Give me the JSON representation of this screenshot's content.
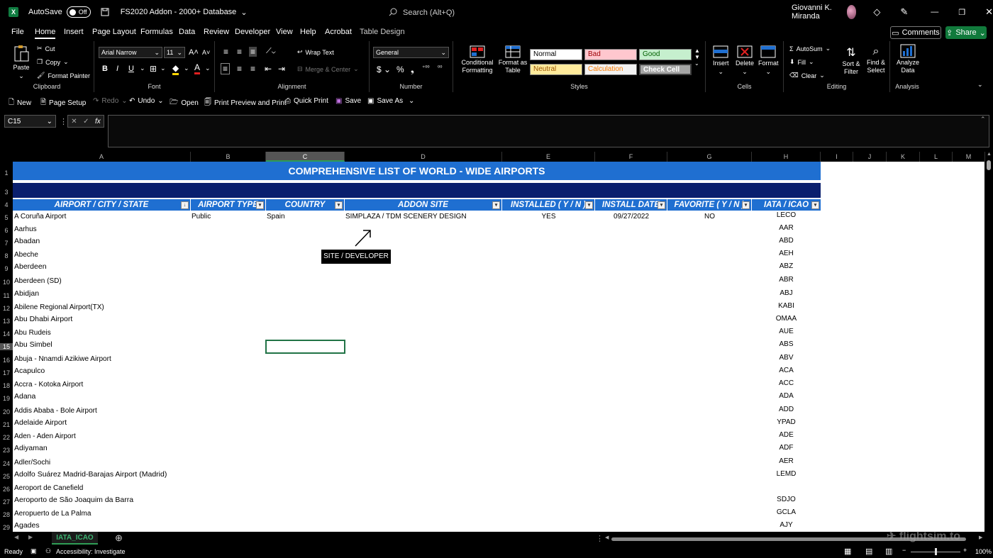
{
  "titlebar": {
    "autosave_label": "AutoSave",
    "autosave_state": "Off",
    "doc_title": "FS2020 Addon - 2000+ Database",
    "search_placeholder": "Search (Alt+Q)",
    "user_name": "Giovanni K. Miranda"
  },
  "menu": [
    "File",
    "Home",
    "Insert",
    "Page Layout",
    "Formulas",
    "Data",
    "Review",
    "Developer",
    "View",
    "Help",
    "Acrobat",
    "Table Design"
  ],
  "menu_active": "Home",
  "comments_label": "Comments",
  "share_label": "Share",
  "ribbon": {
    "clipboard": {
      "paste": "Paste",
      "cut": "Cut",
      "copy": "Copy",
      "format_painter": "Format Painter",
      "label": "Clipboard"
    },
    "font": {
      "name": "Arial Narrow",
      "size": "11",
      "label": "Font"
    },
    "alignment": {
      "wrap": "Wrap Text",
      "merge": "Merge & Center",
      "label": "Alignment"
    },
    "number": {
      "format": "General",
      "label": "Number"
    },
    "styles": {
      "conditional": "Conditional Formatting",
      "format_table": "Format as Table",
      "normal": "Normal",
      "bad": "Bad",
      "good": "Good",
      "neutral": "Neutral",
      "calculation": "Calculation",
      "check": "Check Cell",
      "label": "Styles"
    },
    "cells": {
      "insert": "Insert",
      "delete": "Delete",
      "format": "Format",
      "label": "Cells"
    },
    "editing": {
      "autosum": "AutoSum",
      "fill": "Fill",
      "clear": "Clear",
      "sort": "Sort & Filter",
      "find": "Find & Select",
      "label": "Editing"
    },
    "analysis": {
      "analyze": "Analyze Data",
      "label": "Analysis"
    }
  },
  "qat": [
    "New",
    "Page Setup",
    "Redo",
    "Undo",
    "Open",
    "Print Preview and Print",
    "Quick Print",
    "Save",
    "Save As"
  ],
  "namebox": "C15",
  "columns": [
    "A",
    "B",
    "C",
    "D",
    "E",
    "F",
    "G",
    "H",
    "I",
    "J",
    "K",
    "L",
    "M"
  ],
  "sheet": {
    "title": "COMPREHENSIVE LIST OF WORLD - WIDE AIRPORTS",
    "headers": [
      "AIRPORT / CITY / STATE",
      "AIRPORT TYPE",
      "COUNTRY",
      "ADDON SITE",
      "INSTALLED  ( Y / N )",
      "INSTALL DATE",
      "FAVORITE ( Y / N )",
      "IATA / ICAO"
    ],
    "first_row": {
      "type": "Public",
      "country": "Spain",
      "site": "SIMPLAZA / TDM SCENERY DESIGN",
      "installed": "YES",
      "date": "09/27/2022",
      "favorite": "NO"
    },
    "tooltip": "SITE / DEVELOPER",
    "rows": [
      {
        "n": "5",
        "name": "A Coruña Airport",
        "code": "LECO"
      },
      {
        "n": "6",
        "name": "Aarhus",
        "code": "AAR"
      },
      {
        "n": "7",
        "name": "Abadan",
        "code": "ABD"
      },
      {
        "n": "8",
        "name": "Abeche",
        "code": "AEH"
      },
      {
        "n": "9",
        "name": "Aberdeen",
        "code": "ABZ"
      },
      {
        "n": "10",
        "name": "Aberdeen (SD)",
        "code": "ABR"
      },
      {
        "n": "11",
        "name": "Abidjan",
        "code": "ABJ"
      },
      {
        "n": "12",
        "name": "Abilene Regional Airport(TX)",
        "code": "KABI"
      },
      {
        "n": "13",
        "name": "Abu Dhabi Airport",
        "code": "OMAA"
      },
      {
        "n": "14",
        "name": "Abu Rudeis",
        "code": "AUE"
      },
      {
        "n": "15",
        "name": "Abu Simbel",
        "code": "ABS"
      },
      {
        "n": "16",
        "name": "Abuja - Nnamdi Azikiwe Airport",
        "code": "ABV"
      },
      {
        "n": "17",
        "name": "Acapulco",
        "code": "ACA"
      },
      {
        "n": "18",
        "name": "Accra - Kotoka Airport",
        "code": "ACC"
      },
      {
        "n": "19",
        "name": "Adana",
        "code": "ADA"
      },
      {
        "n": "20",
        "name": "Addis Ababa - Bole Airport",
        "code": "ADD"
      },
      {
        "n": "21",
        "name": "Adelaide Airport",
        "code": "YPAD"
      },
      {
        "n": "22",
        "name": "Aden - Aden Airport",
        "code": "ADE"
      },
      {
        "n": "23",
        "name": "Adiyaman",
        "code": "ADF"
      },
      {
        "n": "24",
        "name": "Adler/Sochi",
        "code": "AER"
      },
      {
        "n": "25",
        "name": "Adolfo Suárez Madrid-Barajas Airport (Madrid)",
        "code": "LEMD"
      },
      {
        "n": "26",
        "name": "Aeroport de Canefield",
        "code": ""
      },
      {
        "n": "27",
        "name": "Aeroporto de São Joaquim da Barra",
        "code": "SDJO"
      },
      {
        "n": "28",
        "name": "Aeropuerto de La Palma",
        "code": "GCLA"
      },
      {
        "n": "29",
        "name": "Agades",
        "code": "AJY"
      }
    ]
  },
  "sheet_tab": "IATA_ICAO",
  "status": {
    "ready": "Ready",
    "accessibility": "Accessibility: Investigate",
    "zoom": "100%"
  },
  "watermark": "flightsim.to"
}
